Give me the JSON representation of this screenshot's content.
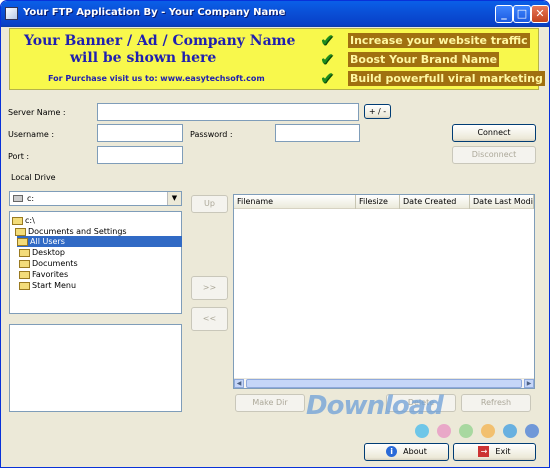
{
  "window": {
    "title": "Your FTP Application By - Your Company Name",
    "controls": {
      "minimize": "_",
      "maximize": "□",
      "close": "✕"
    }
  },
  "banner": {
    "line1": "Your Banner / Ad / Company Name",
    "line2": "will be shown here",
    "line3": "For Purchase visit us to: www.easytechsoft.com",
    "features": [
      "Increase your website traffic",
      "Boost Your Brand Name",
      "Build powerfull viral marketing"
    ]
  },
  "form": {
    "server_label": "Server Name :",
    "server_value": "",
    "plus_minus": "+ / -",
    "username_label": "Username :",
    "username_value": "",
    "password_label": "Password :",
    "password_value": "",
    "port_label": "Port :",
    "port_value": "",
    "connect": "Connect",
    "disconnect": "Disconnect"
  },
  "local": {
    "label": "Local Drive",
    "drive": "c:",
    "tree": [
      "c:\\",
      "Documents and Settings",
      "All Users",
      "Desktop",
      "Documents",
      "Favorites",
      "Start Menu"
    ]
  },
  "transfer": {
    "up": "Up",
    "upload": ">>",
    "download": "<<"
  },
  "remote": {
    "columns": [
      "Filename",
      "Filesize",
      "Date Created",
      "Date Last Modi..."
    ]
  },
  "remote_actions": {
    "make_dir": "Make Dir",
    "delete": "Delete",
    "refresh": "Refresh"
  },
  "watermark": "Download",
  "footer": {
    "about": "About",
    "exit": "Exit"
  },
  "colors": {
    "titlebar": "#0a4fd6",
    "banner_bg": "#f8f84c",
    "banner_text": "#1f1fb0",
    "feature_bg": "#a07010",
    "feature_text": "#fff8a0",
    "check": "#1e8c1e",
    "selection": "#316ac5",
    "dots": [
      "#6ec6e8",
      "#e9a8c8",
      "#a8d8a0",
      "#f2c070",
      "#68b0e0",
      "#7098d8"
    ]
  }
}
